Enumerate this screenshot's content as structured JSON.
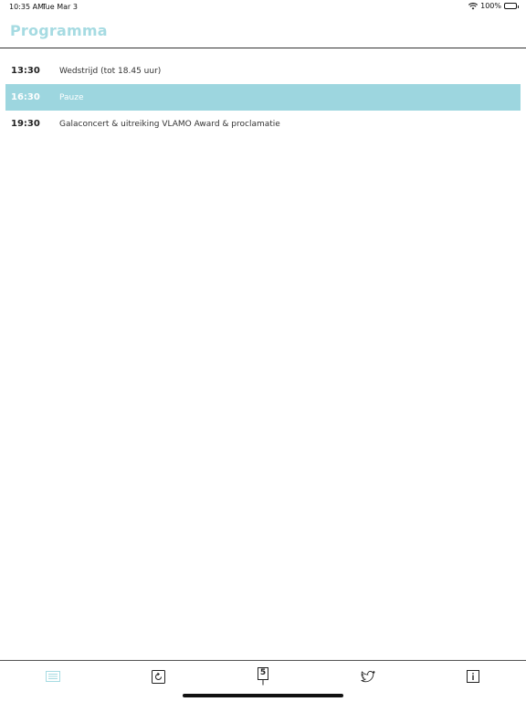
{
  "status_bar": {
    "time": "10:35 AM",
    "date": "Tue Mar 3",
    "battery": "100%"
  },
  "header": {
    "title": "Programma"
  },
  "schedule": [
    {
      "time": "13:30",
      "description": "Wedstrijd (tot 18.45 uur)",
      "selected": false
    },
    {
      "time": "16:30",
      "description": "Pauze",
      "selected": true
    },
    {
      "time": "19:30",
      "description": "Galaconcert & uitreiking VLAMO Award & proclamatie",
      "selected": false
    }
  ],
  "tab_bar": {
    "tabs": [
      {
        "icon": "list-icon",
        "active": true
      },
      {
        "icon": "refresh-icon",
        "active": false
      },
      {
        "icon": "number-5-pin-icon",
        "label": "5",
        "active": false
      },
      {
        "icon": "twitter-icon",
        "active": false
      },
      {
        "icon": "info-icon",
        "active": false
      }
    ]
  },
  "colors": {
    "accent": "#a6dbe2",
    "selected_row": "#9dd6df"
  }
}
